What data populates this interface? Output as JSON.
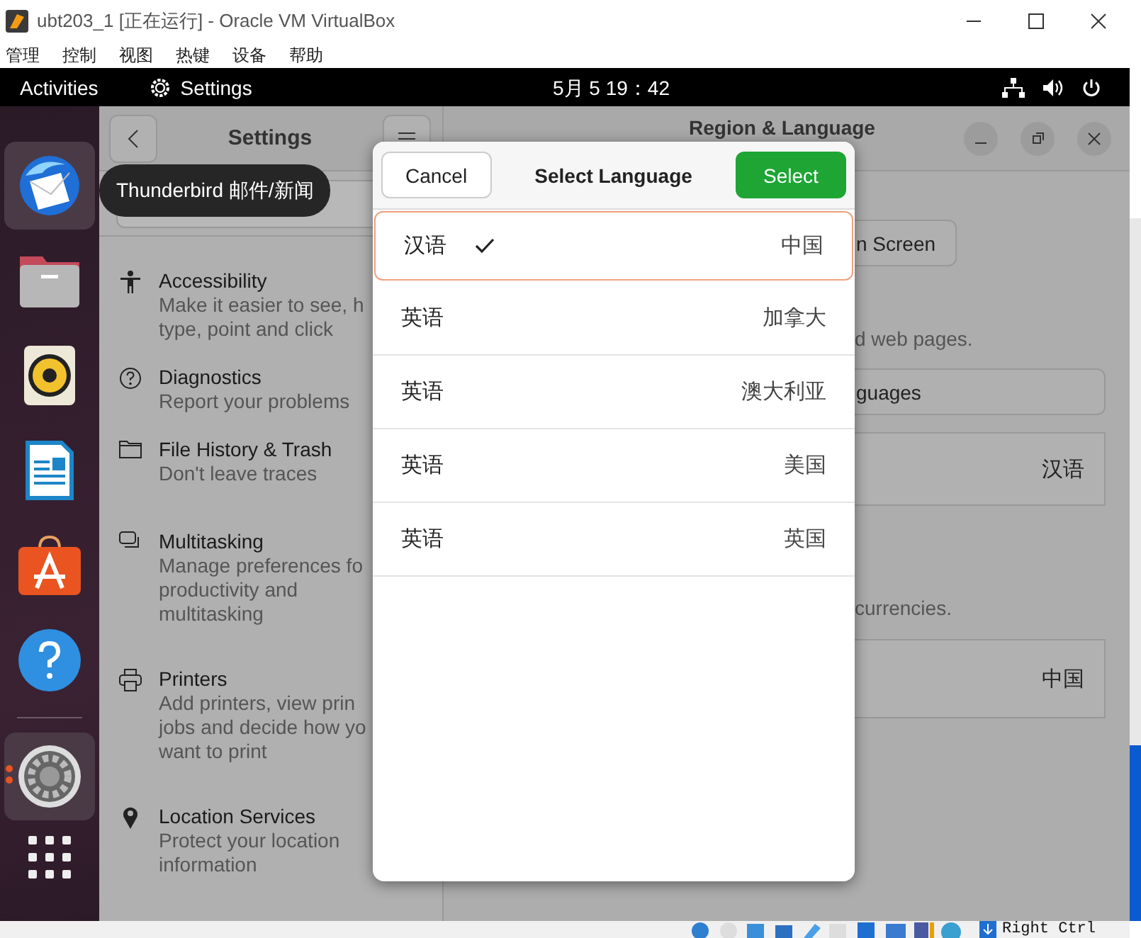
{
  "host_window": {
    "title": "ubt203_1 [正在运行] - Oracle VM VirtualBox",
    "menu": [
      "管理",
      "控制",
      "视图",
      "热键",
      "设备",
      "帮助"
    ]
  },
  "top_bar": {
    "activities": "Activities",
    "app": "Settings",
    "clock": "5月 5 19：42"
  },
  "dock": [
    {
      "kind": "thunderbird",
      "selected": true,
      "running": false
    },
    {
      "kind": "files",
      "selected": false,
      "running": false
    },
    {
      "kind": "rhythmbox",
      "selected": false,
      "running": false
    },
    {
      "kind": "writer",
      "selected": false,
      "running": false
    },
    {
      "kind": "software",
      "selected": false,
      "running": false
    },
    {
      "kind": "help",
      "selected": false,
      "running": false
    },
    {
      "kind": "settings",
      "selected": true,
      "running": true
    }
  ],
  "tooltip": "Thunderbird 邮件/新闻",
  "settings": {
    "title": "Settings",
    "panel_title": "Region & Language",
    "sidebar": [
      {
        "kind": "accessibility",
        "title": "Accessibility",
        "description": "Make it easier to see, h\ntype, point and click"
      },
      {
        "kind": "diagnostics",
        "title": "Diagnostics",
        "description": "Report your problems"
      },
      {
        "kind": "history",
        "title": "File History & Trash",
        "description": "Don't leave traces"
      },
      {
        "kind": "multitasking",
        "title": "Multitasking",
        "description": "Manage preferences fo\nproductivity and\nmultitasking"
      },
      {
        "kind": "printers",
        "title": "Printers",
        "description": "Add printers, view prin\njobs and decide how yo\nwant to print"
      },
      {
        "kind": "location",
        "title": "Location Services",
        "description": "Protect your location\ninformation"
      }
    ],
    "content": {
      "screen_button": "n Screen",
      "hint_1": "d web pages.",
      "languages_button": "guages",
      "language_value": "汉语",
      "hint_2": "currencies.",
      "formats_value": "中国"
    }
  },
  "dialog": {
    "cancel": "Cancel",
    "title": "Select Language",
    "select": "Select",
    "languages": [
      {
        "name": "汉语",
        "region": "中国",
        "selected": true
      },
      {
        "name": "英语",
        "region": "加拿大",
        "selected": false
      },
      {
        "name": "英语",
        "region": "澳大利亚",
        "selected": false
      },
      {
        "name": "英语",
        "region": "美国",
        "selected": false
      },
      {
        "name": "英语",
        "region": "英国",
        "selected": false
      }
    ]
  },
  "status_bar": {
    "host_key": "Right Ctrl"
  }
}
